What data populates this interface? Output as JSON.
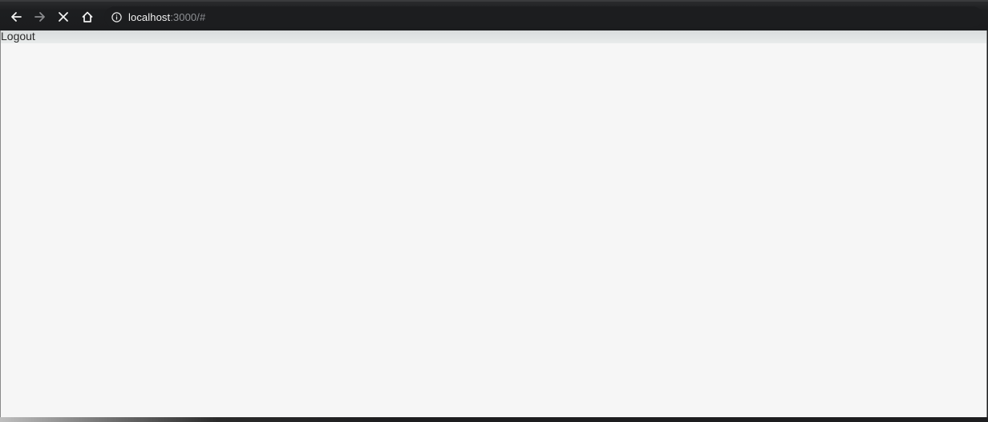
{
  "browser": {
    "url_host": "localhost",
    "url_rest": ":3000/#",
    "icons": {
      "back": "arrow-left-icon",
      "forward": "arrow-right-icon",
      "stop": "close-icon",
      "home": "home-icon",
      "site_info": "info-icon"
    }
  },
  "page": {
    "logout_label": "Logout"
  }
}
